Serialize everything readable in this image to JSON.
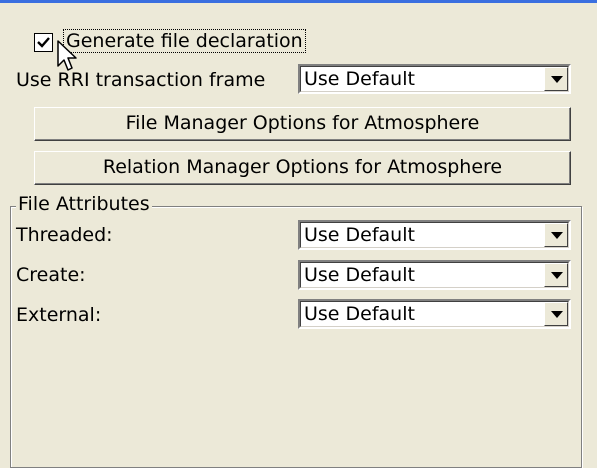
{
  "generate_decl": {
    "label": "Generate file declaration",
    "checked": true
  },
  "rri_frame": {
    "label": "Use RRI transaction frame",
    "value": "Use Default"
  },
  "buttons": {
    "file_manager": "File Manager Options for Atmosphere",
    "relation_manager": "Relation Manager Options for Atmosphere"
  },
  "file_attributes": {
    "title": "File Attributes",
    "threaded": {
      "label": "Threaded:",
      "value": "Use Default"
    },
    "create": {
      "label": "Create:",
      "value": "Use Default"
    },
    "external": {
      "label": "External:",
      "value": "Use Default"
    }
  }
}
